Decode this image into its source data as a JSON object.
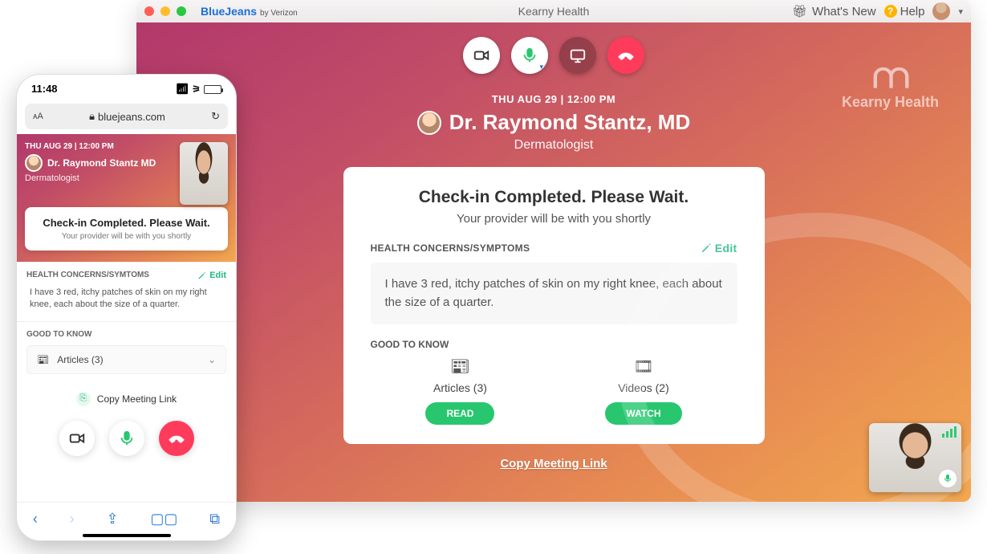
{
  "desktop": {
    "brand": {
      "name": "BlueJeans",
      "byline": "by Verizon"
    },
    "title": "Kearny Health",
    "whatsNew": "What's New",
    "help": "Help",
    "kearnyBrand": "Kearny Health"
  },
  "meeting": {
    "datetime": "THU AUG 29 |  12:00 PM",
    "provider": "Dr. Raymond Stantz, MD",
    "specialty": "Dermatologist"
  },
  "checkin": {
    "title": "Check-in Completed. Please Wait.",
    "subtitle": "Your provider will be with you shortly",
    "symptomsLabel": "HEALTH CONCERNS/SYMPTOMS",
    "editLabel": "Edit",
    "symptoms": "I have 3 red, itchy patches of skin on my right knee, each about the size of a quarter.",
    "gtkLabel": "GOOD TO KNOW",
    "articles": {
      "label": "Articles (3)",
      "button": "READ"
    },
    "videos": {
      "label": "Videos (2)",
      "button": "WATCH"
    }
  },
  "copyLink": "Copy Meeting Link",
  "phone": {
    "time": "11:48",
    "url": "bluejeans.com",
    "datetime": "THU AUG 29 |  12:00 PM",
    "provider": "Dr. Raymond Stantz MD",
    "specialty": "Dermatologist",
    "checkinTitle": "Check-in Completed. Please Wait.",
    "checkinSub": "Your provider will be with you shortly",
    "symptomsLabel": "HEALTH CONCERNS/SYMTOMS",
    "editLabel": "Edit",
    "symptoms": "I have 3 red, itchy patches of skin on my right knee, each about the size of a quarter.",
    "gtkLabel": "GOOD TO KNOW",
    "articles": "Articles (3)",
    "copy": "Copy Meeting Link"
  }
}
